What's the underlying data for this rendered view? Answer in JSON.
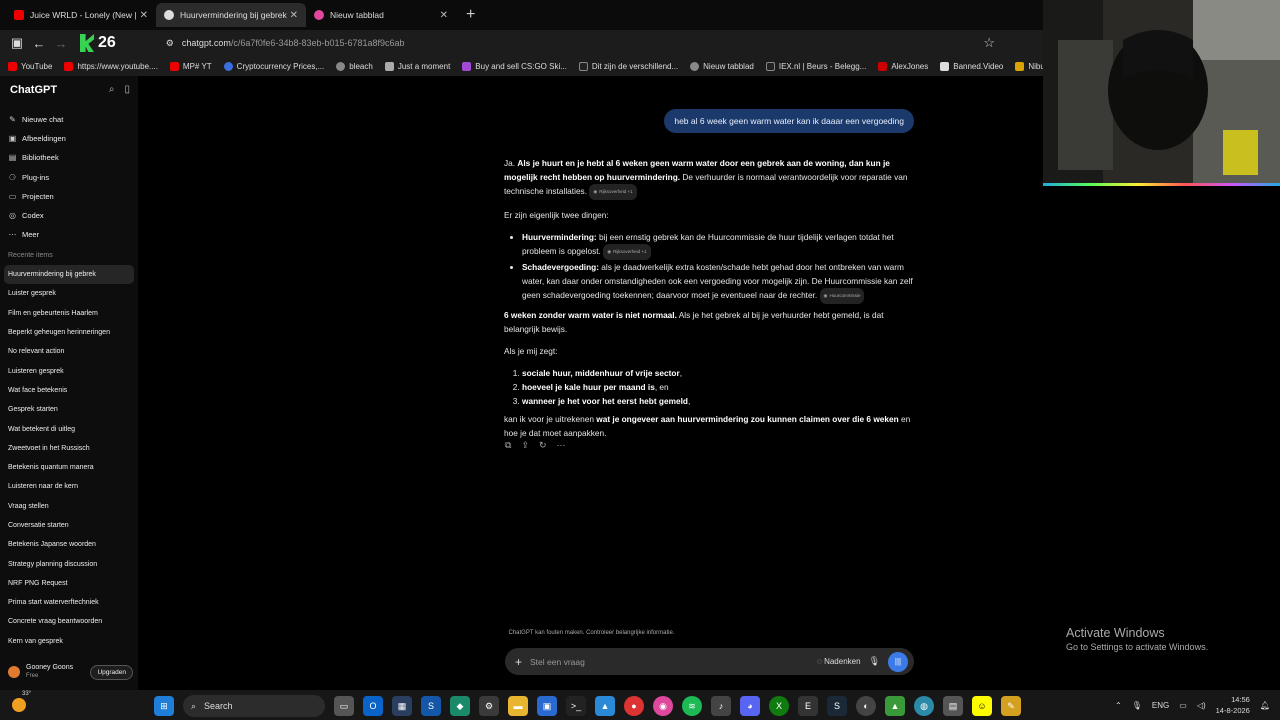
{
  "tabs": [
    {
      "label": "Juice WRLD - Lonely (New |",
      "icon": "youtube-icon",
      "active": false
    },
    {
      "label": "Huurvermindering bij gebrek",
      "icon": "chatgpt-icon",
      "active": true
    },
    {
      "label": "Nieuw tabblad",
      "icon": "firefox-icon",
      "active": false
    }
  ],
  "toolbar": {
    "counter": "26",
    "url_host": "chatgpt.com",
    "url_path": "/c/6a7f0fe6-34b8-83eb-b015-6781a8f9c6ab"
  },
  "bookmarks": [
    "YouTube",
    "https://www.youtube....",
    "MP# YT",
    "Cryptocurrency Prices,...",
    "bleach",
    "Just a moment",
    "Buy and sell CS:GO Ski...",
    "Dit zijn de verschillend...",
    "Nieuw tabblad",
    "IEX.nl | Beurs - Belegg...",
    "AlexJones",
    "Banned.Video",
    "Niburu.co :: Onthulle"
  ],
  "sidebar": {
    "brand": "ChatGPT",
    "menu": [
      {
        "label": "Nieuwe chat",
        "icon": "edit-icon"
      },
      {
        "label": "Afbeeldingen",
        "icon": "image-icon"
      },
      {
        "label": "Bibliotheek",
        "icon": "library-icon"
      },
      {
        "label": "Plug-ins",
        "icon": "plugin-icon"
      },
      {
        "label": "Projecten",
        "icon": "folder-icon"
      },
      {
        "label": "Codex",
        "icon": "codex-icon"
      },
      {
        "label": "Meer",
        "icon": "more-icon"
      }
    ],
    "recent_heading": "Recente items",
    "recent": [
      "Huurvermindering bij gebrek",
      "Luister gesprek",
      "Film en gebeurtenis Haarlem",
      "Beperkt geheugen herinneringen",
      "No relevant action",
      "Luisteren gesprek",
      "Wat face betekenis",
      "Gesprek starten",
      "Wat betekent di uitleg",
      "Zweetvoet in het Russisch",
      "Betekenis quantum manera",
      "Luisteren naar de kern",
      "Vraag stellen",
      "Conversatie starten",
      "Betekenis Japanse woorden",
      "Strategy planning discussion",
      "NRF PNG Request",
      "Prima start waterverftechniek",
      "Concrete vraag beantwoorden",
      "Kern van gesprek"
    ],
    "user": {
      "name": "Gooney Goons",
      "plan": "Free",
      "upgrade": "Upgraden"
    }
  },
  "chat": {
    "user_message": "heb al 6 week geen warm water kan ik daaar een vergoeding",
    "p1_a": "Ja. ",
    "p1_b": "Als je huurt en je hebt al 6 weken geen warm water door een gebrek aan de woning, dan kun je mogelijk recht hebben op huurvermindering.",
    "p1_c": " De verhuurder is normaal verantwoordelijk voor reparatie van technische installaties.",
    "cite1": "Rijksoverheid +1",
    "p2": "Er zijn eigenlijk twee dingen:",
    "bullet1_b": "Huurvermindering:",
    "bullet1_t": " bij een ernstig gebrek kan de Huurcommissie de huur tijdelijk verlagen totdat het probleem is opgelost.",
    "cite2": "Rijksoverheid +1",
    "bullet2_b": "Schadevergoeding:",
    "bullet2_t": " als je daadwerkelijk extra kosten/schade hebt gehad door het ontbreken van warm water, kan daar onder omstandigheden ook een vergoeding voor mogelijk zijn. De Huurcommissie kan zelf geen schadevergoeding toekennen; daarvoor moet je eventueel naar de rechter.",
    "cite3": "Huurcommissie",
    "p3_b": "6 weken zonder warm water is niet normaal.",
    "p3_t": " Als je het gebrek al bij je verhuurder hebt gemeld, is dat belangrijk bewijs.",
    "p4": "Als je mij zegt:",
    "list": [
      {
        "b": "sociale huur, middenhuur of vrije sector",
        "t": ","
      },
      {
        "b": "hoeveel je kale huur per maand is",
        "t": ", en"
      },
      {
        "b": "wanneer je het voor het eerst hebt gemeld",
        "t": ","
      }
    ],
    "p5_a": "kan ik voor je uitrekenen ",
    "p5_b": "wat je ongeveer aan huurvermindering zou kunnen claimen over die 6 weken",
    "p5_c": " en hoe je dat moet aanpakken.",
    "disclaimer": "ChatGPT kan fouten maken. Controleer belangrijke informatie.",
    "composer_placeholder": "Stel een vraag",
    "think_label": "Nadenken"
  },
  "watermark": {
    "line1": "Activate Windows",
    "line2": "Go to Settings to activate Windows."
  },
  "taskbar": {
    "weather_temp": "33°",
    "search_label": "Search",
    "lang": "ENG",
    "time": "14:56",
    "date": "14-8-2026"
  }
}
